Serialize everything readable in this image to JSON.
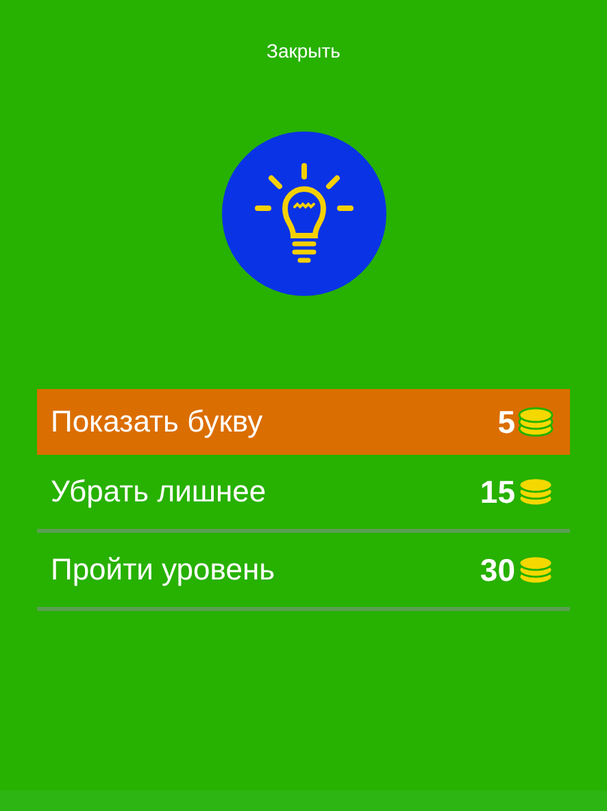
{
  "close_label": "Закрыть",
  "options": [
    {
      "label": "Показать букву",
      "price": "5",
      "selected": true
    },
    {
      "label": "Убрать лишнее",
      "price": "15",
      "selected": false
    },
    {
      "label": "Пройти уровень",
      "price": "30",
      "selected": false
    }
  ]
}
